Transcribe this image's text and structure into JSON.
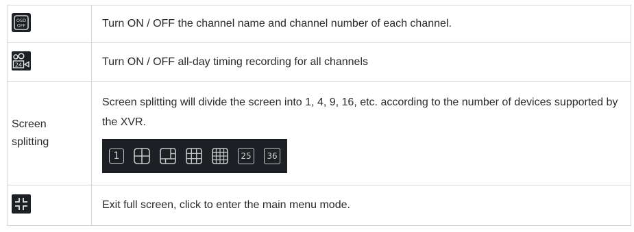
{
  "rows": [
    {
      "icon": "osd-off-icon",
      "icon_text": [
        "OSD",
        "OFF"
      ],
      "description": "Turn ON / OFF the channel name and channel number of each channel."
    },
    {
      "icon": "timing-record-24-icon",
      "icon_text": "24",
      "description": "Turn ON / OFF all-day timing recording for all channels"
    },
    {
      "label": "Screen splitting",
      "description": "Screen splitting will divide the screen into 1, 4, 9, 16, etc. according to the number of devices supported by the XVR.",
      "split_options": [
        {
          "icon": "split-1-icon",
          "text": "1"
        },
        {
          "icon": "split-4-icon"
        },
        {
          "icon": "split-6-icon"
        },
        {
          "icon": "split-9-icon"
        },
        {
          "icon": "split-16-icon"
        },
        {
          "icon": "split-25-icon",
          "text": "25"
        },
        {
          "icon": "split-36-icon",
          "text": "36"
        }
      ]
    },
    {
      "icon": "exit-fullscreen-icon",
      "description": "Exit full screen, click to enter the main menu mode."
    }
  ],
  "colors": {
    "icon_bg": "#1c1f24",
    "icon_fg": "#d4d4d4",
    "border": "#d6d6d6",
    "text": "#2a2a2a"
  }
}
